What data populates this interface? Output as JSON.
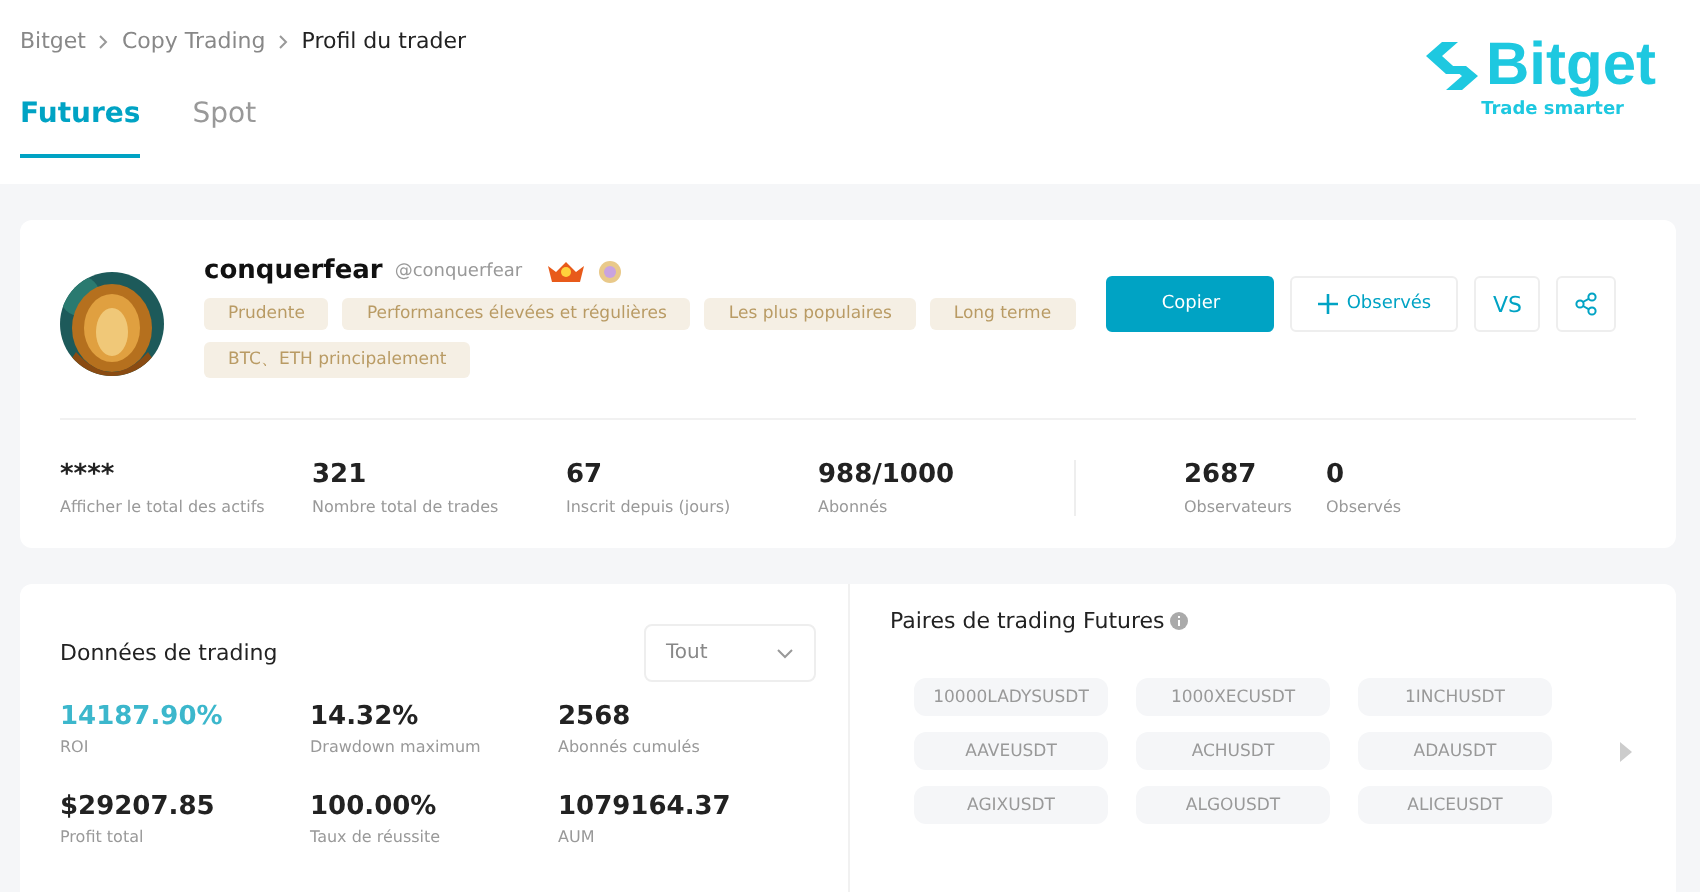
{
  "breadcrumb": [
    {
      "label": "Bitget",
      "current": false
    },
    {
      "label": "Copy Trading",
      "current": false
    },
    {
      "label": "Profil du trader",
      "current": true
    }
  ],
  "logo": {
    "name": "Bitget",
    "tagline": "Trade smarter"
  },
  "tabs": [
    {
      "label": "Futures",
      "selected": true
    },
    {
      "label": "Spot",
      "selected": false
    }
  ],
  "profile": {
    "name": "conquerfear",
    "handle": "@conquerfear",
    "tags": [
      "Prudente",
      "Performances élevées et régulières",
      "Les plus populaires",
      "Long terme",
      "BTC、ETH principalement"
    ],
    "buttons": {
      "copy": "Copier",
      "watch": "Observés",
      "compare": "VS"
    },
    "stats": [
      {
        "value": "****",
        "label": "Afficher le total des actifs"
      },
      {
        "value": "321",
        "label": "Nombre total de trades"
      },
      {
        "value": "67",
        "label": "Inscrit depuis (jours)"
      },
      {
        "value": "988/1000",
        "label": "Abonnés"
      },
      {
        "value": "2687",
        "label": "Observateurs"
      },
      {
        "value": "0",
        "label": "Observés"
      }
    ]
  },
  "trading_data": {
    "title": "Données de trading",
    "period": "Tout",
    "metrics": [
      {
        "value": "14187.90%",
        "label": "ROI",
        "highlighted": true
      },
      {
        "value": "14.32%",
        "label": "Drawdown maximum",
        "highlighted": false
      },
      {
        "value": "2568",
        "label": "Abonnés cumulés",
        "highlighted": false
      },
      {
        "value": "$29207.85",
        "label": "Profit total",
        "highlighted": false
      },
      {
        "value": "100.00%",
        "label": "Taux de réussite",
        "highlighted": false
      },
      {
        "value": "1079164.37",
        "label": "AUM",
        "highlighted": false
      }
    ]
  },
  "pairs": {
    "title": "Paires de trading Futures",
    "items": [
      "10000LADYSUSDT",
      "1000XECUSDT",
      "1INCHUSDT",
      "AAVEUSDT",
      "ACHUSDT",
      "ADAUSDT",
      "AGIXUSDT",
      "ALGOUSDT",
      "ALICEUSDT"
    ]
  }
}
